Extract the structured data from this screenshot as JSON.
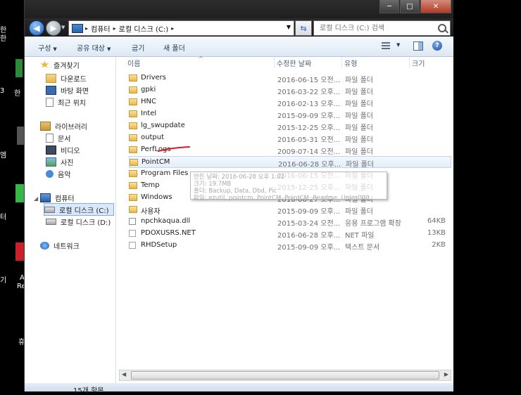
{
  "desktop": {
    "fragments": [
      "한",
      "한",
      "3",
      "한",
      "엠",
      "터",
      "기",
      "A",
      "Re",
      "휴"
    ]
  },
  "window": {
    "caption_buttons": {
      "minimize": "─",
      "maximize": "□",
      "close": "✕"
    }
  },
  "address_bar": {
    "segments": [
      "컴퓨터",
      "로컬 디스크 (C:)"
    ],
    "separator": "▸"
  },
  "search": {
    "placeholder": "로컬 디스크 (C:) 검색"
  },
  "toolbar": {
    "organize": "구성",
    "share": "공유 대상",
    "burn": "굽기",
    "new_folder": "새 폴더"
  },
  "nav_pane": {
    "favorites": {
      "label": "즐겨찾기",
      "items": [
        "다운로드",
        "바탕 화면",
        "최근 위치"
      ]
    },
    "libraries": {
      "label": "라이브러리",
      "items": [
        "문서",
        "비디오",
        "사진",
        "음악"
      ]
    },
    "computer": {
      "label": "컴퓨터",
      "items": [
        "로컬 디스크 (C:)",
        "로컬 디스크 (D:)"
      ]
    },
    "network": {
      "label": "네트워크"
    }
  },
  "columns": {
    "name": "이름",
    "date": "수정한 날짜",
    "type": "유형",
    "size": "크기"
  },
  "files": [
    {
      "name": "Drivers",
      "date": "2016-06-15 오전...",
      "type": "파일 폴더",
      "size": "",
      "kind": "folder"
    },
    {
      "name": "gpki",
      "date": "2016-03-22 오후...",
      "type": "파일 폴더",
      "size": "",
      "kind": "folder"
    },
    {
      "name": "HNC",
      "date": "2016-02-13 오후...",
      "type": "파일 폴더",
      "size": "",
      "kind": "folder"
    },
    {
      "name": "Intel",
      "date": "2015-09-09 오후...",
      "type": "파일 폴더",
      "size": "",
      "kind": "folder"
    },
    {
      "name": "lg_swupdate",
      "date": "2015-12-25 오후...",
      "type": "파일 폴더",
      "size": "",
      "kind": "folder"
    },
    {
      "name": "output",
      "date": "2016-05-31 오전...",
      "type": "파일 폴더",
      "size": "",
      "kind": "folder"
    },
    {
      "name": "PerfLogs",
      "date": "2009-07-14 오전...",
      "type": "파일 폴더",
      "size": "",
      "kind": "folder"
    },
    {
      "name": "PointCM",
      "date": "2016-06-28 오후...",
      "type": "파일 폴더",
      "size": "",
      "kind": "folder"
    },
    {
      "name": "Program Files",
      "date": "2016-06-15 오전...",
      "type": "파일 폴더",
      "size": "",
      "kind": "folder"
    },
    {
      "name": "Temp",
      "date": "2015-12-25 오후...",
      "type": "파일 폴더",
      "size": "",
      "kind": "folder"
    },
    {
      "name": "Windows",
      "date": "2016-06-27 오후...",
      "type": "파일 폴더",
      "size": "",
      "kind": "folder"
    },
    {
      "name": "사용자",
      "date": "2015-09-09 오후...",
      "type": "파일 폴더",
      "size": "",
      "kind": "folder"
    },
    {
      "name": "npchkaqua.dll",
      "date": "2015-03-24 오전...",
      "type": "응용 프로그램 확장",
      "size": "64KB",
      "kind": "dll"
    },
    {
      "name": "PDOXUSRS.NET",
      "date": "2016-06-28 오후...",
      "type": "NET 파일",
      "size": "13KB",
      "kind": "file"
    },
    {
      "name": "RHDSetup",
      "date": "2015-09-09 오후...",
      "type": "텍스트 문서",
      "size": "2KB",
      "kind": "file"
    }
  ],
  "selected_file": "PointCM",
  "tooltip": {
    "line1": "만든 날짜: 2016-06-28 오후 1:02",
    "line2": "크기: 19.7MB",
    "line3": "폴더: Backup, Data, Dbd, Pic",
    "line4": "파일: ezutil, pointcm, PointCM, PointCM, Readme, Unins000"
  },
  "status_bar": {
    "item_count": "15개 항목"
  },
  "colors": {
    "selection": "#d9e8fa",
    "annotation": "#e0141e",
    "titlebar": "#1f1f1f"
  }
}
